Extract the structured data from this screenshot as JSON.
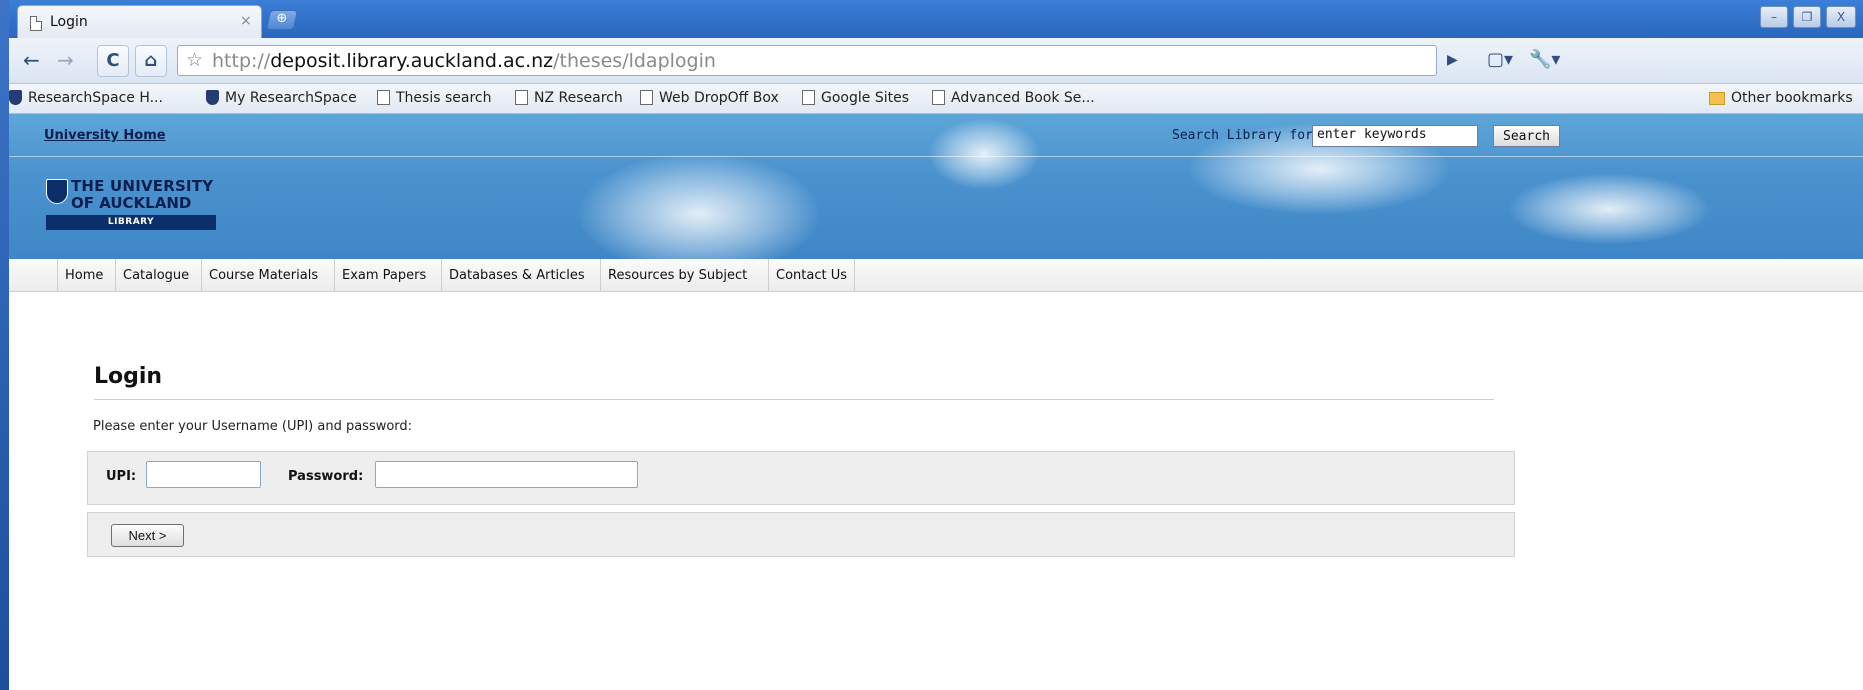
{
  "browser": {
    "tab": {
      "title": "Login",
      "close_glyph": "×",
      "new_tab_glyph": "⊕"
    },
    "window_buttons": [
      "–",
      "❐",
      "X"
    ],
    "address": {
      "prefix": "http://",
      "host": "deposit.library.auckland.ac.nz",
      "path": "/theses/ldaplogin"
    },
    "toolbar_right": {
      "play_glyph": "▶",
      "page_glyph": "▢▾",
      "wrench_glyph": "🔧▾"
    },
    "nav": {
      "back": "←",
      "forward": "→",
      "reload": "C",
      "home": "⌂",
      "star": "☆"
    },
    "bookmarks": [
      {
        "label": "ResearchSpace H...",
        "icon": "shield-icon"
      },
      {
        "label": "My ResearchSpace",
        "icon": "shield-icon"
      },
      {
        "label": "Thesis search",
        "icon": "page-icon"
      },
      {
        "label": "NZ Research",
        "icon": "page-icon"
      },
      {
        "label": "Web DropOff Box",
        "icon": "page-icon"
      },
      {
        "label": "Google Sites",
        "icon": "page-icon"
      },
      {
        "label": "Advanced Book Se...",
        "icon": "page-icon"
      }
    ],
    "other_bookmarks": "Other bookmarks"
  },
  "header": {
    "university_home": "University Home",
    "search_label": "Search Library for:",
    "search_value": "enter keywords",
    "search_button": "Search",
    "logo_line1": "THE UNIVERSITY",
    "logo_line2": "OF AUCKLAND",
    "logo_bar": "LIBRARY"
  },
  "menu": [
    "Home",
    "Catalogue",
    "Course Materials",
    "Exam Papers",
    "Databases & Articles",
    "Resources by Subject",
    "Contact Us"
  ],
  "login": {
    "title": "Login",
    "instruction": "Please enter your Username (UPI) and password:",
    "upi_label": "UPI:",
    "upi_value": "",
    "password_label": "Password:",
    "password_value": "",
    "next_button": "Next >"
  }
}
